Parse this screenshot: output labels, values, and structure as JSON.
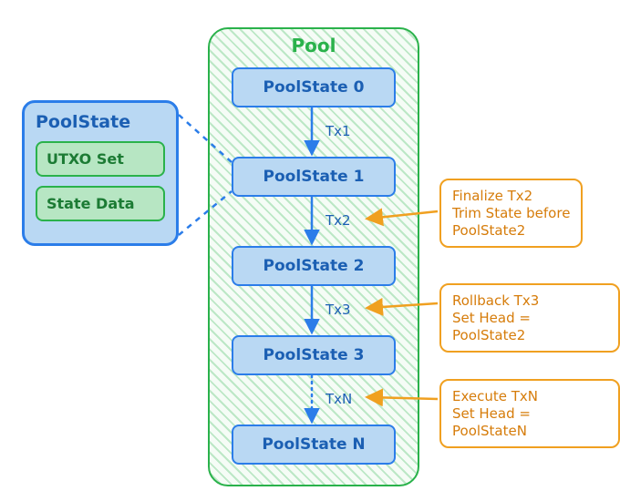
{
  "pool": {
    "title": "Pool"
  },
  "states": {
    "s0": "PoolState 0",
    "s1": "PoolState 1",
    "s2": "PoolState 2",
    "s3": "PoolState 3",
    "sn": "PoolState N"
  },
  "tx": {
    "t1": "Tx1",
    "t2": "Tx2",
    "t3": "Tx3",
    "tn": "TxN"
  },
  "notes": {
    "n1_l1": "Finalize Tx2",
    "n1_l2": "Trim State before",
    "n1_l3": "PoolState2",
    "n2_l1": "Rollback Tx3",
    "n2_l2": "Set Head = PoolState2",
    "n3_l1": "Execute TxN",
    "n3_l2": "Set Head = PoolStateN"
  },
  "card": {
    "title": "PoolState",
    "utxo": "UTXO Set",
    "data": "State Data"
  }
}
